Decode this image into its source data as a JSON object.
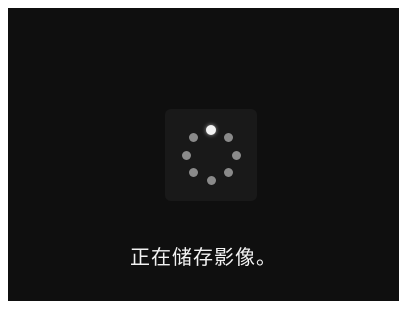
{
  "dialog": {
    "status_message": "正在储存影像。",
    "spinner_icon": "loading-spinner-icon",
    "spinner_dot_count": 8,
    "spinner_active_dot": 0
  },
  "colors": {
    "screen_background": "#0f0f0f",
    "spinner_background": "#191919",
    "dot_inactive": "#8a8a8a",
    "dot_active": "#f2f2f2",
    "text": "#f2f2f2"
  }
}
